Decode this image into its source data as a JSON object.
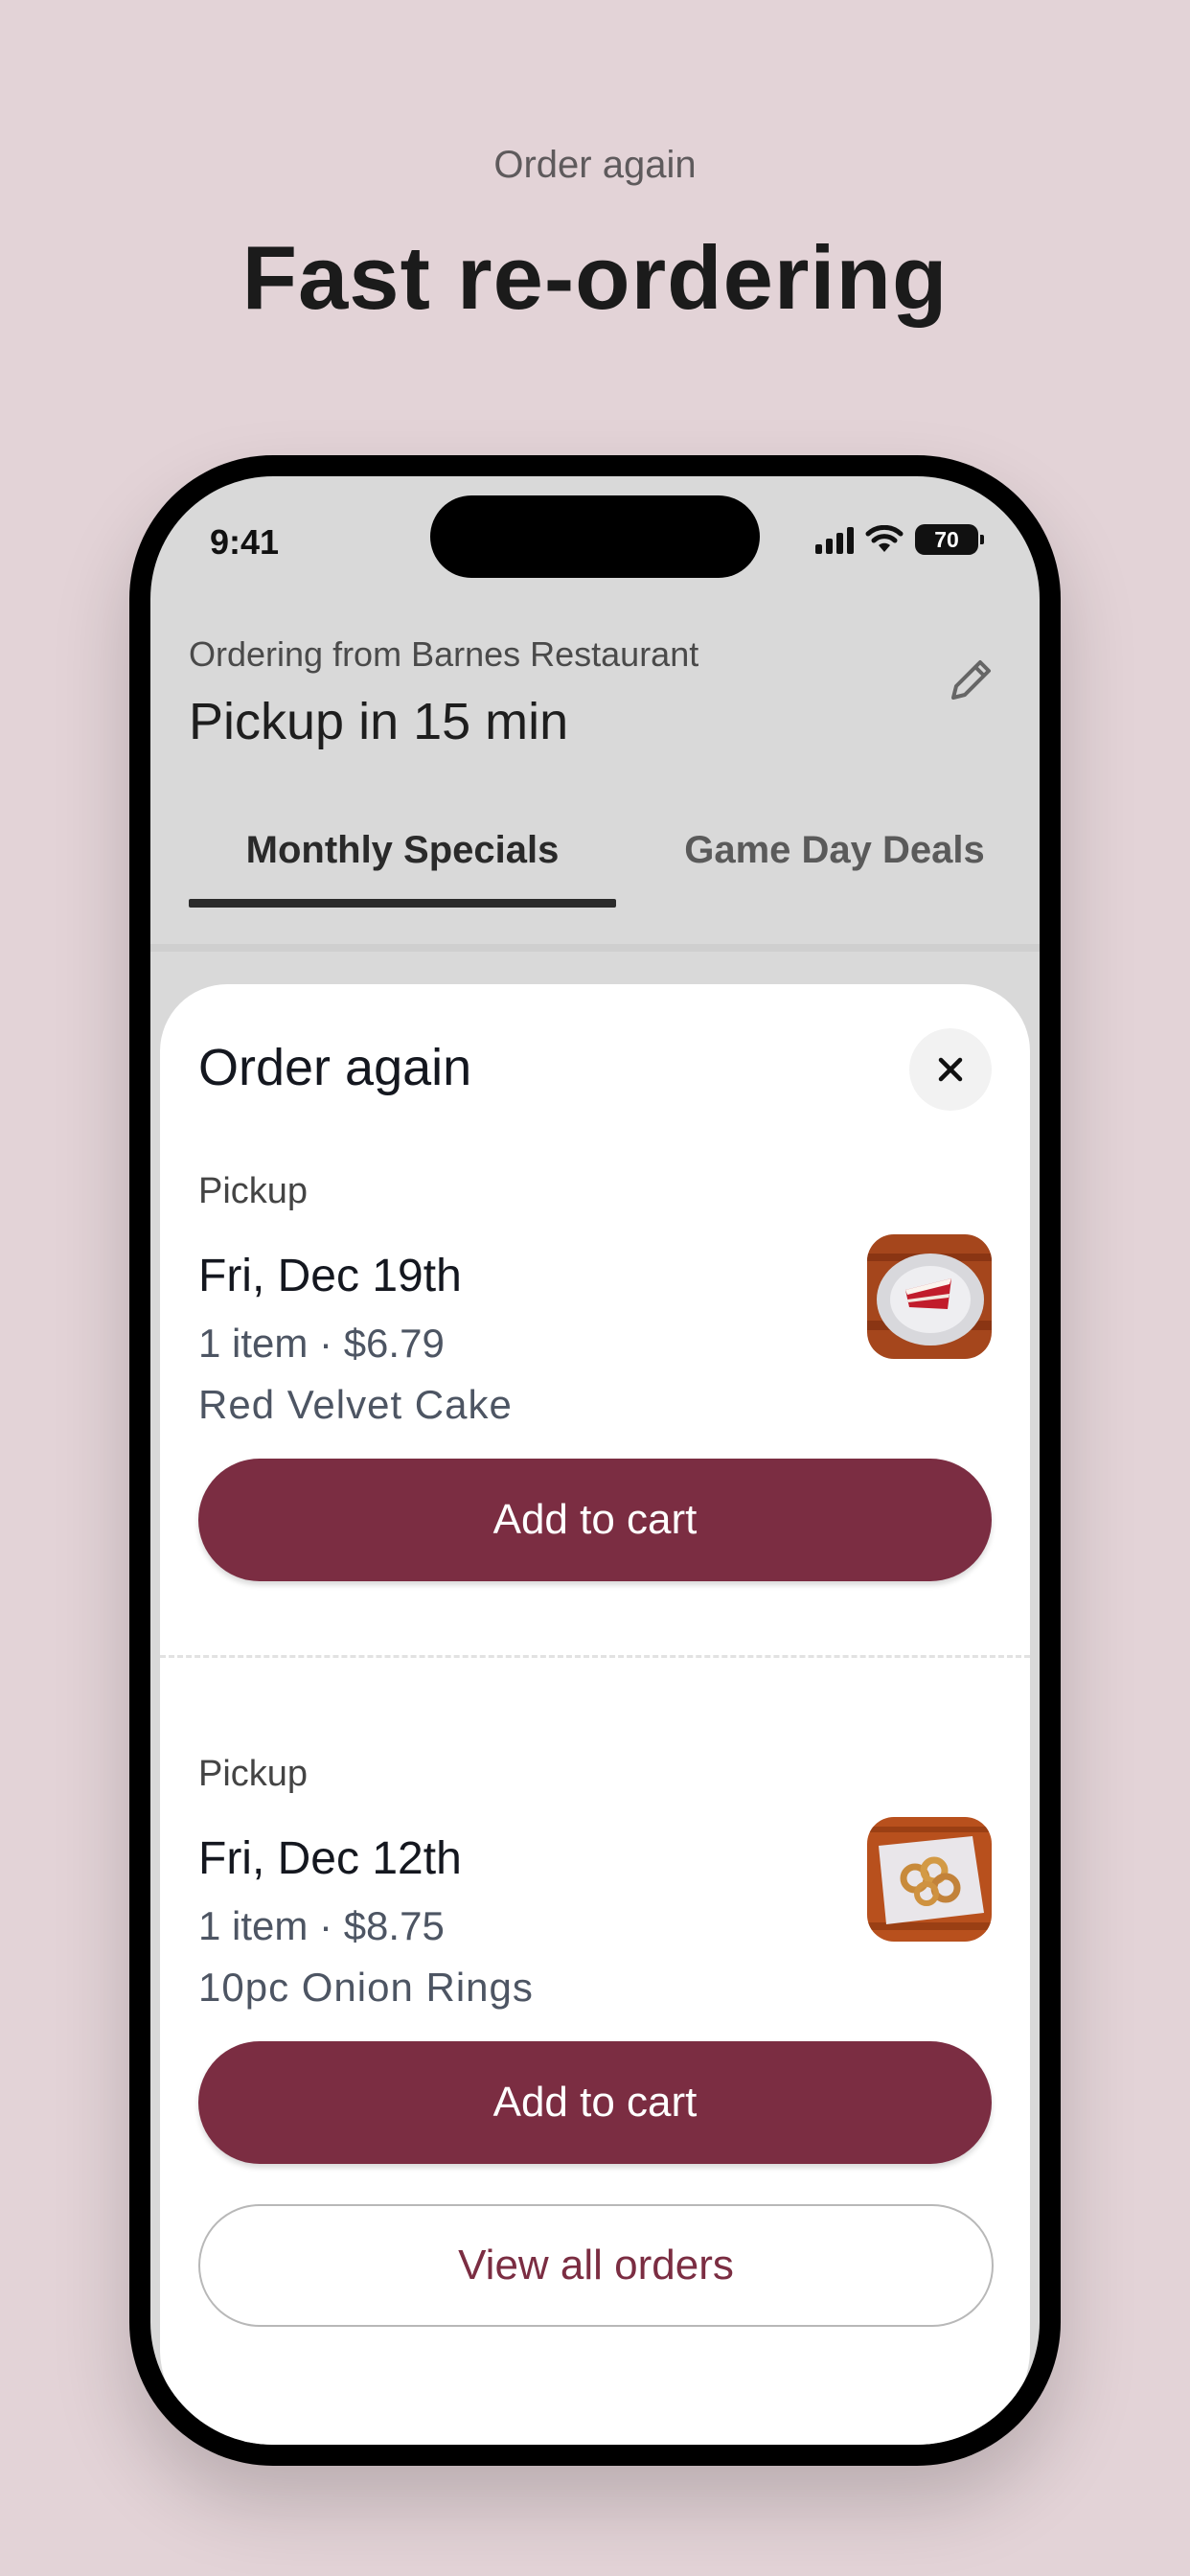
{
  "promo": {
    "eyebrow": "Order again",
    "headline": "Fast re-ordering"
  },
  "status_bar": {
    "time": "9:41",
    "battery": "70",
    "icons": [
      "signal-icon",
      "wifi-icon",
      "battery-icon"
    ]
  },
  "header": {
    "ordering_from": "Ordering from Barnes Restaurant",
    "pickup_title": "Pickup in 15 min",
    "edit_icon": "pencil-icon"
  },
  "tabs": [
    {
      "label": "Monthly Specials",
      "active": true
    },
    {
      "label": "Game Day Deals",
      "active": false
    }
  ],
  "sheet": {
    "title": "Order again",
    "close_icon": "close-icon",
    "orders": [
      {
        "mode": "Pickup",
        "date": "Fri, Dec 19th",
        "summary": "1 item · $6.79",
        "item": "Red Velvet Cake",
        "button": "Add to cart"
      },
      {
        "mode": "Pickup",
        "date": "Fri, Dec 12th",
        "summary": "1 item · $8.75",
        "item": "10pc Onion Rings",
        "button": "Add to cart"
      }
    ],
    "view_all": "View all orders"
  },
  "colors": {
    "background": "#e3d3d7",
    "accent": "#7b2d42"
  }
}
